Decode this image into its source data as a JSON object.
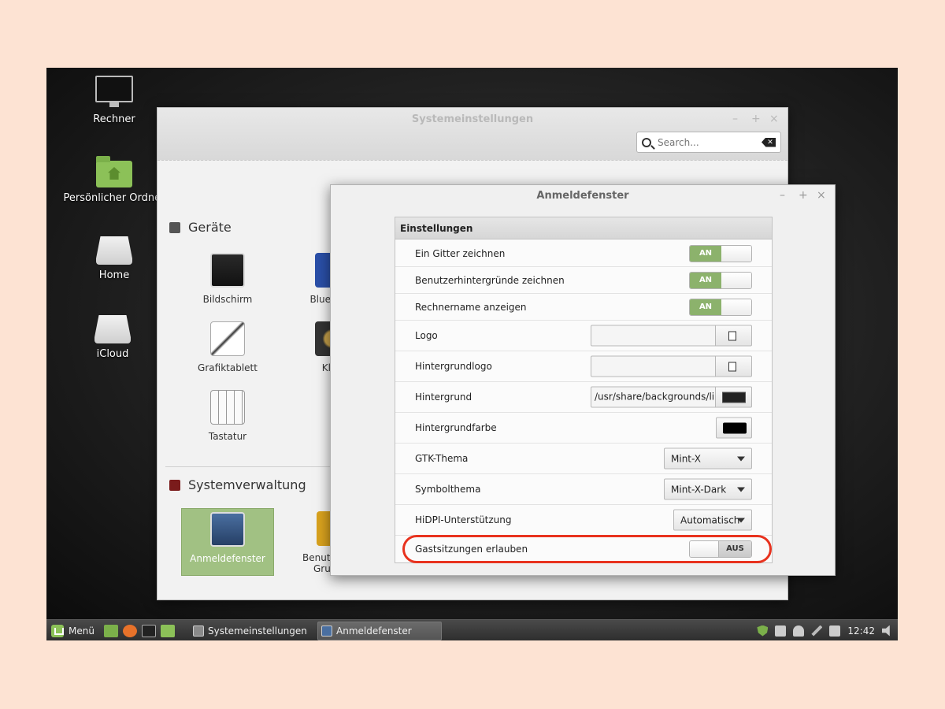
{
  "desktop": {
    "icons": [
      {
        "label": "Rechner"
      },
      {
        "label": "Persönlicher Ordner"
      },
      {
        "label": "Home"
      },
      {
        "label": "iCloud"
      }
    ]
  },
  "sys_window": {
    "title": "Systemeinstellungen",
    "controls": {
      "minimize": "–",
      "maximize": "+",
      "close": "×"
    },
    "search_placeholder": "Search...",
    "sections": {
      "devices": {
        "title": "Geräte",
        "items": [
          "Bildschirm",
          "Blue",
          "Grafiktablett",
          "Kl",
          "Tastatur"
        ]
      },
      "admin": {
        "title": "Systemverwaltung",
        "items": [
          "Anmeldefenster",
          "Benut",
          "Gru"
        ]
      }
    }
  },
  "dialog": {
    "title": "Anmeldefenster",
    "controls": {
      "minimize": "–",
      "maximize": "+",
      "close": "×"
    },
    "panel_title": "Einstellungen",
    "rows": {
      "grid": {
        "label": "Ein Gitter zeichnen",
        "state": "AN"
      },
      "user_bg": {
        "label": "Benutzerhintergründe zeichnen",
        "state": "AN"
      },
      "hostname": {
        "label": "Rechnername anzeigen",
        "state": "AN"
      },
      "logo": {
        "label": "Logo",
        "value": ""
      },
      "bg_logo": {
        "label": "Hintergrundlogo",
        "value": ""
      },
      "background": {
        "label": "Hintergrund",
        "value": "/usr/share/backgrounds/lin"
      },
      "bg_color": {
        "label": "Hintergrundfarbe",
        "color": "#000000"
      },
      "gtk_theme": {
        "label": "GTK-Thema",
        "value": "Mint-X"
      },
      "icon_theme": {
        "label": "Symbolthema",
        "value": "Mint-X-Dark"
      },
      "hidpi": {
        "label": "HiDPI-Unterstützung",
        "value": "Automatisch"
      },
      "guest": {
        "label": "Gastsitzungen erlauben",
        "state": "AUS"
      }
    }
  },
  "taskbar": {
    "menu_label": "Menü",
    "tasks": [
      "Systemeinstellungen",
      "Anmeldefenster"
    ],
    "clock": "12:42"
  },
  "colors": {
    "accent_green": "#8cb26c",
    "highlight_red": "#e8321e"
  }
}
